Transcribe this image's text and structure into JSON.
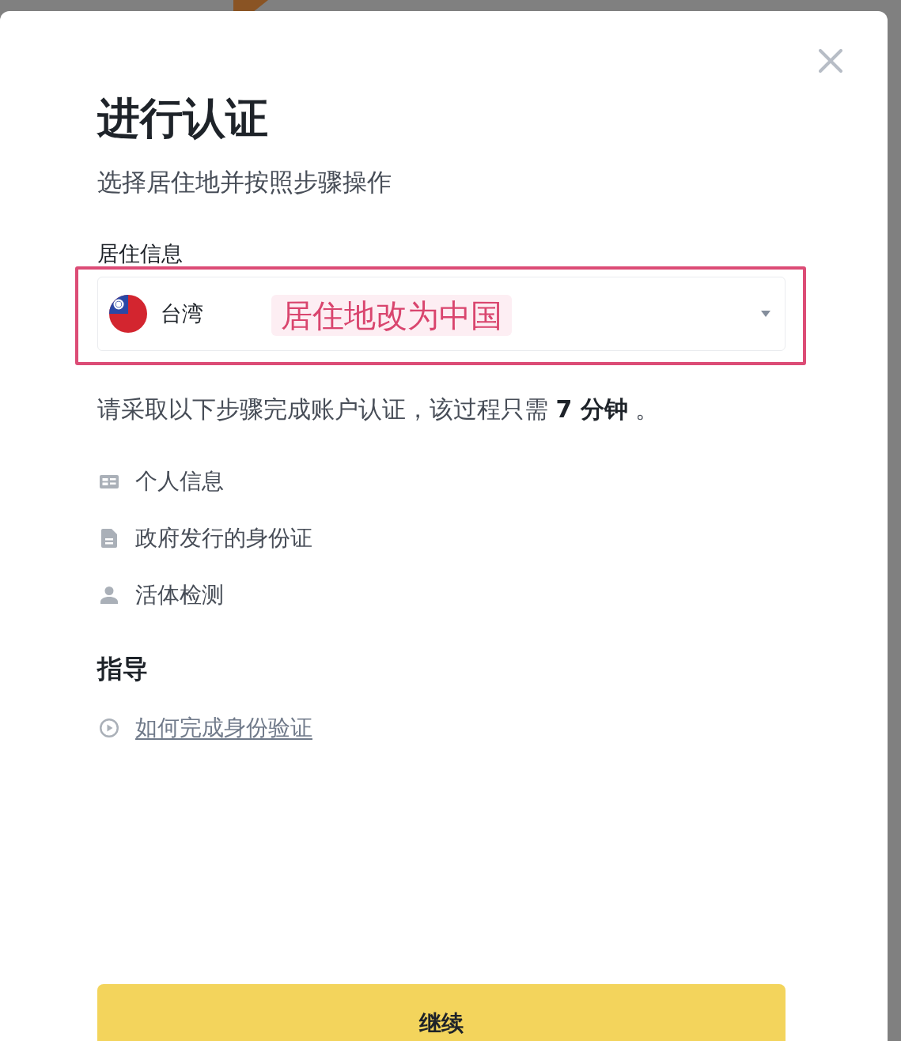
{
  "dialog": {
    "title": "进行认证",
    "subtitle": "选择居住地并按照步骤操作"
  },
  "residence": {
    "label": "居住信息",
    "country": "台湾",
    "annotation": "居住地改为中国"
  },
  "steps_intro": "请采取以下步骤完成账户认证，该过程只需 **7 分钟** 。",
  "steps": [
    {
      "kind": "id-card",
      "label": "个人信息"
    },
    {
      "kind": "document",
      "label": "政府发行的身份证"
    },
    {
      "kind": "person",
      "label": "活体检测"
    }
  ],
  "guide": {
    "heading": "指导",
    "link": "如何完成身份验证"
  },
  "button": "继续"
}
